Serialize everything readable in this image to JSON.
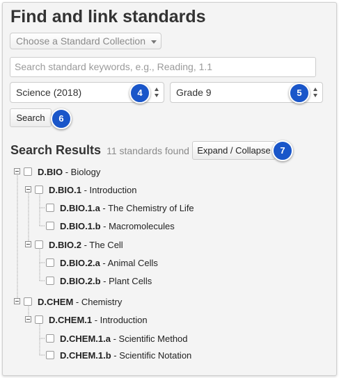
{
  "title": "Find and link standards",
  "collection_select": {
    "placeholder": "Choose a Standard Collection"
  },
  "search_input": {
    "placeholder": "Search standard keywords, e.g., Reading, 1.1"
  },
  "subject_select": {
    "value": "Science (2018)"
  },
  "grade_select": {
    "value": "Grade 9"
  },
  "search_button": {
    "label": "Search"
  },
  "results": {
    "heading": "Search Results",
    "count": "11 standards found",
    "expand_label": "Expand / Collapse"
  },
  "badges": {
    "b4": "4",
    "b5": "5",
    "b6": "6",
    "b7": "7"
  },
  "badge_color": "#1a56c9",
  "tree": [
    {
      "code": "D.BIO",
      "label": " - Biology"
    },
    {
      "code": "D.BIO.1",
      "label": " - Introduction"
    },
    {
      "code": "D.BIO.1.a",
      "label": " - The Chemistry of Life"
    },
    {
      "code": "D.BIO.1.b",
      "label": " - Macromolecules"
    },
    {
      "code": "D.BIO.2",
      "label": " - The Cell"
    },
    {
      "code": "D.BIO.2.a",
      "label": " - Animal Cells"
    },
    {
      "code": "D.BIO.2.b",
      "label": " - Plant Cells"
    },
    {
      "code": "D.CHEM",
      "label": " - Chemistry"
    },
    {
      "code": "D.CHEM.1",
      "label": " - Introduction"
    },
    {
      "code": "D.CHEM.1.a",
      "label": " - Scientific Method"
    },
    {
      "code": "D.CHEM.1.b",
      "label": " - Scientific Notation"
    }
  ]
}
